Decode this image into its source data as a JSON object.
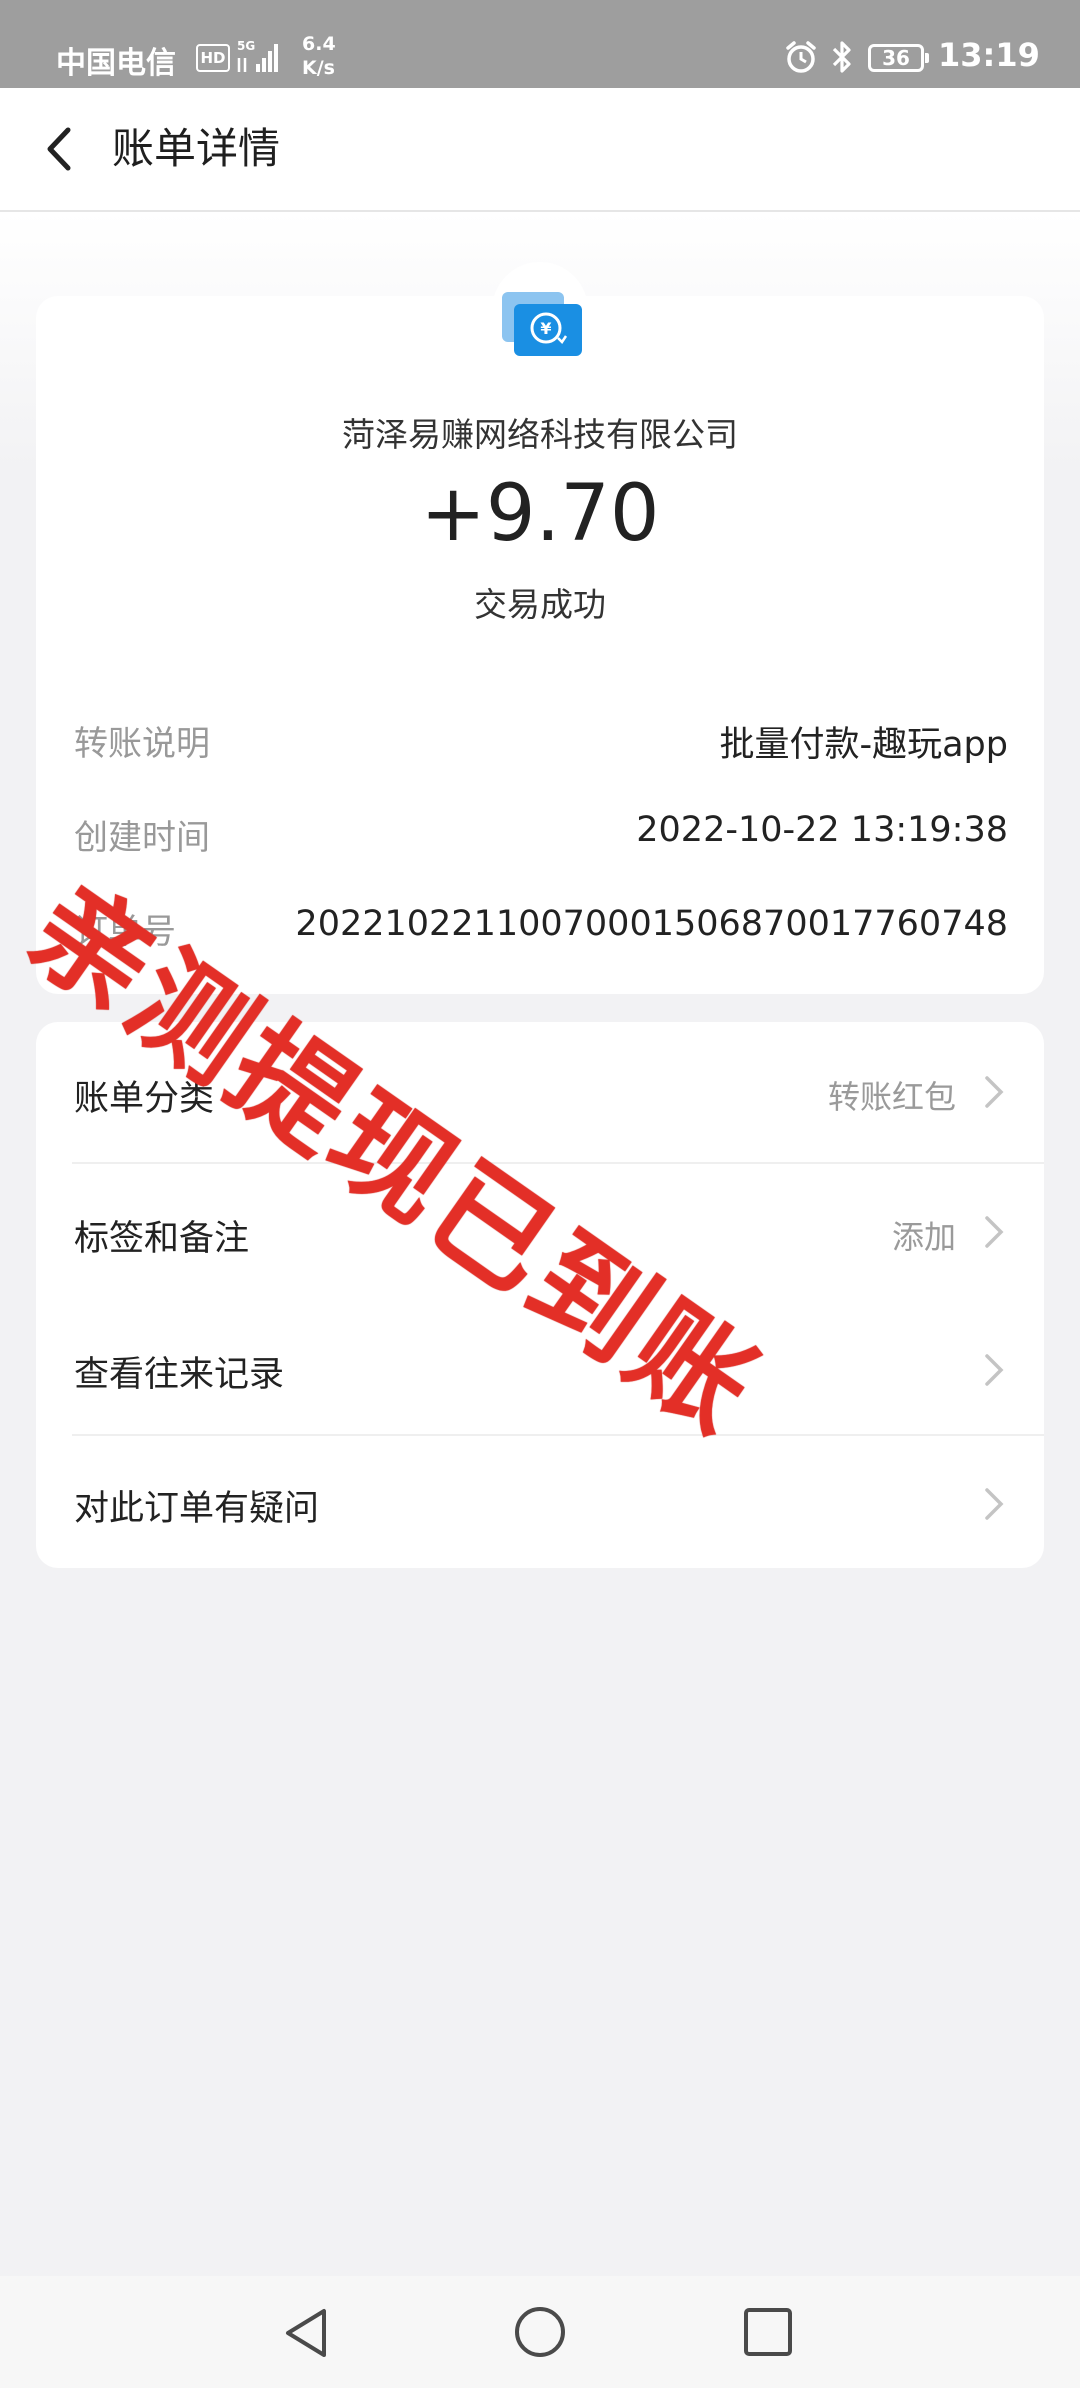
{
  "status_bar": {
    "carrier": "中国电信",
    "hd_badge": "HD",
    "network": "5G",
    "speed_value": "6.4",
    "speed_unit": "K/s",
    "battery": "36",
    "time": "13:19",
    "icons": [
      "signal-icon",
      "alarm-icon",
      "bluetooth-icon",
      "battery-icon"
    ]
  },
  "header": {
    "title": "账单详情",
    "back_icon": "chevron-left-icon"
  },
  "summary": {
    "icon": "transfer-yuan-icon",
    "merchant": "菏泽易赚网络科技有限公司",
    "amount": "+9.70",
    "status": "交易成功"
  },
  "details": [
    {
      "label": "转账说明",
      "value": "批量付款-趣玩app"
    },
    {
      "label": "创建时间",
      "value": "2022-10-22 13:19:38"
    },
    {
      "label": "订单号",
      "value": "20221022110070001506870017760748"
    }
  ],
  "menu": [
    {
      "label": "账单分类",
      "value": "转账红包"
    },
    {
      "label": "标签和备注",
      "value": "添加"
    },
    {
      "label": "查看往来记录",
      "value": ""
    },
    {
      "label": "对此订单有疑问",
      "value": ""
    }
  ],
  "watermark": "亲测提现已到账",
  "colors": {
    "accent_blue": "#1a8fe3",
    "watermark_red": "#e8322a",
    "status_bar": "#9e9e9e",
    "background": "#f2f2f4"
  },
  "nav_icons": [
    "nav-back-icon",
    "nav-home-icon",
    "nav-recent-icon"
  ]
}
